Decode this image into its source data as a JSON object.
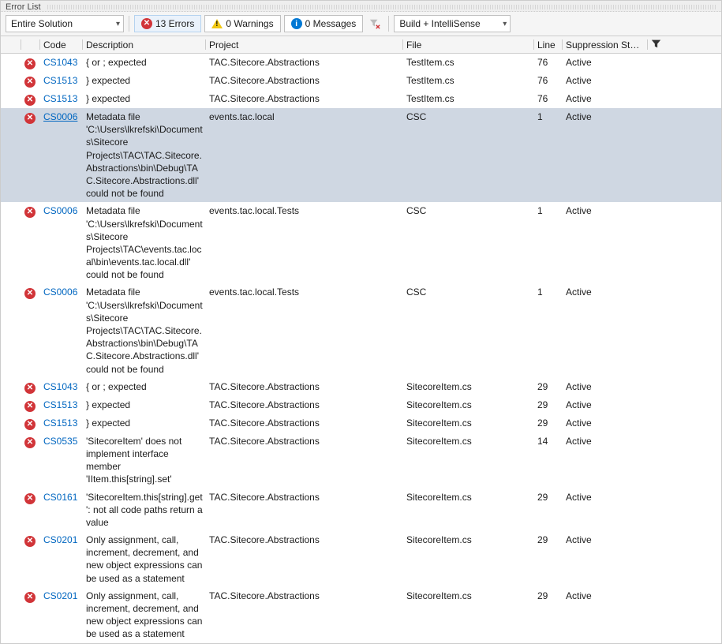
{
  "window": {
    "title": "Error List"
  },
  "toolbar": {
    "scope": "Entire Solution",
    "errors_label": "13 Errors",
    "warnings_label": "0 Warnings",
    "messages_label": "0 Messages",
    "build_filter": "Build + IntelliSense"
  },
  "columns": {
    "code": "Code",
    "description": "Description",
    "project": "Project",
    "file": "File",
    "line": "Line",
    "suppression": "Suppression St…"
  },
  "rows": [
    {
      "code": "CS1043",
      "desc": "{ or ; expected",
      "project": "TAC.Sitecore.Abstractions",
      "file": "TestItem.cs",
      "line": "76",
      "supp": "Active",
      "sel": false
    },
    {
      "code": "CS1513",
      "desc": "} expected",
      "project": "TAC.Sitecore.Abstractions",
      "file": "TestItem.cs",
      "line": "76",
      "supp": "Active",
      "sel": false
    },
    {
      "code": "CS1513",
      "desc": "} expected",
      "project": "TAC.Sitecore.Abstractions",
      "file": "TestItem.cs",
      "line": "76",
      "supp": "Active",
      "sel": false
    },
    {
      "code": "CS0006",
      "desc": "Metadata file 'C:\\Users\\lkrefski\\Documents\\Sitecore Projects\\TAC\\TAC.Sitecore.Abstractions\\bin\\Debug\\TAC.Sitecore.Abstractions.dll' could not be found",
      "project": "events.tac.local",
      "file": "CSC",
      "line": "1",
      "supp": "Active",
      "sel": true
    },
    {
      "code": "CS0006",
      "desc": "Metadata file 'C:\\Users\\lkrefski\\Documents\\Sitecore Projects\\TAC\\events.tac.local\\bin\\events.tac.local.dll' could not be found",
      "project": "events.tac.local.Tests",
      "file": "CSC",
      "line": "1",
      "supp": "Active",
      "sel": false
    },
    {
      "code": "CS0006",
      "desc": "Metadata file 'C:\\Users\\lkrefski\\Documents\\Sitecore Projects\\TAC\\TAC.Sitecore.Abstractions\\bin\\Debug\\TAC.Sitecore.Abstractions.dll' could not be found",
      "project": "events.tac.local.Tests",
      "file": "CSC",
      "line": "1",
      "supp": "Active",
      "sel": false
    },
    {
      "code": "CS1043",
      "desc": "{ or ; expected",
      "project": "TAC.Sitecore.Abstractions",
      "file": "SitecoreItem.cs",
      "line": "29",
      "supp": "Active",
      "sel": false
    },
    {
      "code": "CS1513",
      "desc": "} expected",
      "project": "TAC.Sitecore.Abstractions",
      "file": "SitecoreItem.cs",
      "line": "29",
      "supp": "Active",
      "sel": false
    },
    {
      "code": "CS1513",
      "desc": "} expected",
      "project": "TAC.Sitecore.Abstractions",
      "file": "SitecoreItem.cs",
      "line": "29",
      "supp": "Active",
      "sel": false
    },
    {
      "code": "CS0535",
      "desc": "'SitecoreItem' does not implement interface member 'IItem.this[string].set'",
      "project": "TAC.Sitecore.Abstractions",
      "file": "SitecoreItem.cs",
      "line": "14",
      "supp": "Active",
      "sel": false
    },
    {
      "code": "CS0161",
      "desc": "'SitecoreItem.this[string].get': not all code paths return a value",
      "project": "TAC.Sitecore.Abstractions",
      "file": "SitecoreItem.cs",
      "line": "29",
      "supp": "Active",
      "sel": false
    },
    {
      "code": "CS0201",
      "desc": "Only assignment, call, increment, decrement, and new object expressions can be used as a statement",
      "project": "TAC.Sitecore.Abstractions",
      "file": "SitecoreItem.cs",
      "line": "29",
      "supp": "Active",
      "sel": false
    },
    {
      "code": "CS0201",
      "desc": "Only assignment, call, increment, decrement, and new object expressions can be used as a statement",
      "project": "TAC.Sitecore.Abstractions",
      "file": "SitecoreItem.cs",
      "line": "29",
      "supp": "Active",
      "sel": false
    }
  ]
}
